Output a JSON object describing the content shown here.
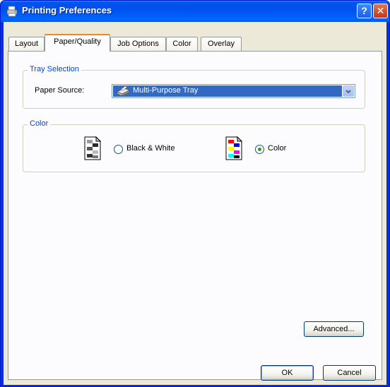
{
  "window": {
    "title": "Printing Preferences",
    "help_glyph": "?",
    "close_glyph": "✕"
  },
  "tabs": [
    {
      "label": "Layout",
      "active": false
    },
    {
      "label": "Paper/Quality",
      "active": true
    },
    {
      "label": "Job Options",
      "active": false
    },
    {
      "label": "Color",
      "active": false
    },
    {
      "label": "Overlay",
      "active": false
    }
  ],
  "tray_selection": {
    "group_label": "Tray Selection",
    "paper_source_label": "Paper Source:",
    "paper_source_value": "Multi-Purpose Tray",
    "paper_source_icon": "printer-tray-icon"
  },
  "color": {
    "group_label": "Color",
    "options": [
      {
        "label": "Black & White",
        "selected": false,
        "icon": "grayscale-document-icon"
      },
      {
        "label": "Color",
        "selected": true,
        "icon": "color-document-icon"
      }
    ]
  },
  "buttons": {
    "advanced": "Advanced...",
    "ok": "OK",
    "cancel": "Cancel"
  },
  "colors": {
    "title_bar": "#0058ee",
    "dialog_bg": "#ece9d8",
    "selection": "#316ac5",
    "group_label": "#0046d5"
  }
}
